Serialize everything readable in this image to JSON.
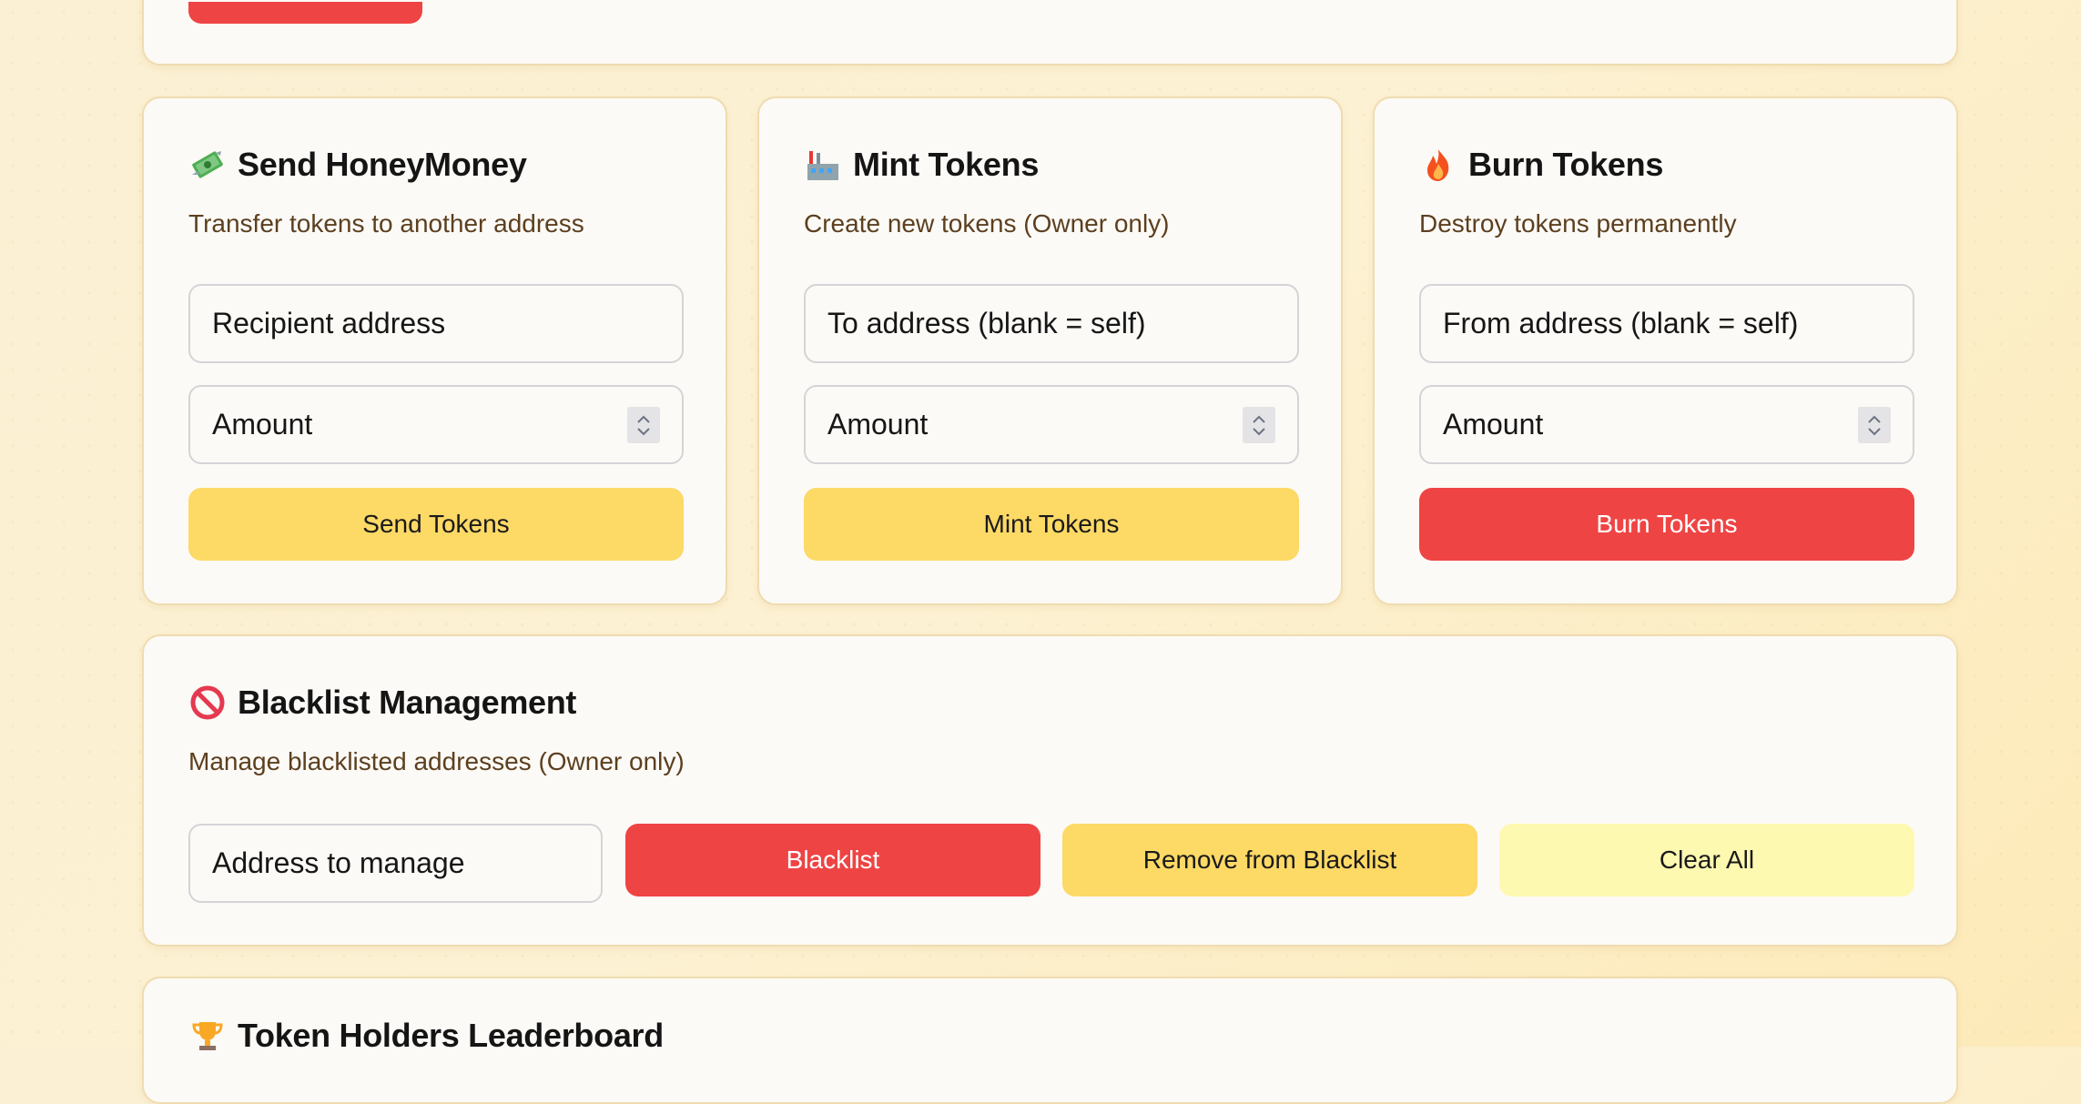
{
  "send_card": {
    "icon": "money-with-wings-icon",
    "title": "Send HoneyMoney",
    "subtitle": "Transfer tokens to another address",
    "recipient_placeholder": "Recipient address",
    "amount_placeholder": "Amount",
    "button_label": "Send Tokens"
  },
  "mint_card": {
    "icon": "factory-icon",
    "title": "Mint Tokens",
    "subtitle": "Create new tokens (Owner only)",
    "to_placeholder": "To address (blank = self)",
    "amount_placeholder": "Amount",
    "button_label": "Mint Tokens"
  },
  "burn_card": {
    "icon": "fire-icon",
    "title": "Burn Tokens",
    "subtitle": "Destroy tokens permanently",
    "from_placeholder": "From address (blank = self)",
    "amount_placeholder": "Amount",
    "button_label": "Burn Tokens"
  },
  "blacklist_card": {
    "icon": "prohibited-icon",
    "title": "Blacklist Management",
    "subtitle": "Manage blacklisted addresses (Owner only)",
    "address_placeholder": "Address to manage",
    "blacklist_label": "Blacklist",
    "remove_label": "Remove from Blacklist",
    "clear_label": "Clear All"
  },
  "leaderboard_card": {
    "icon": "trophy-icon",
    "title": "Token Holders Leaderboard"
  },
  "colors": {
    "accent_yellow": "#fdd966",
    "danger_red": "#ef4444",
    "pale_yellow": "#fef9b0",
    "subtitle_brown": "#5c3f1f"
  }
}
